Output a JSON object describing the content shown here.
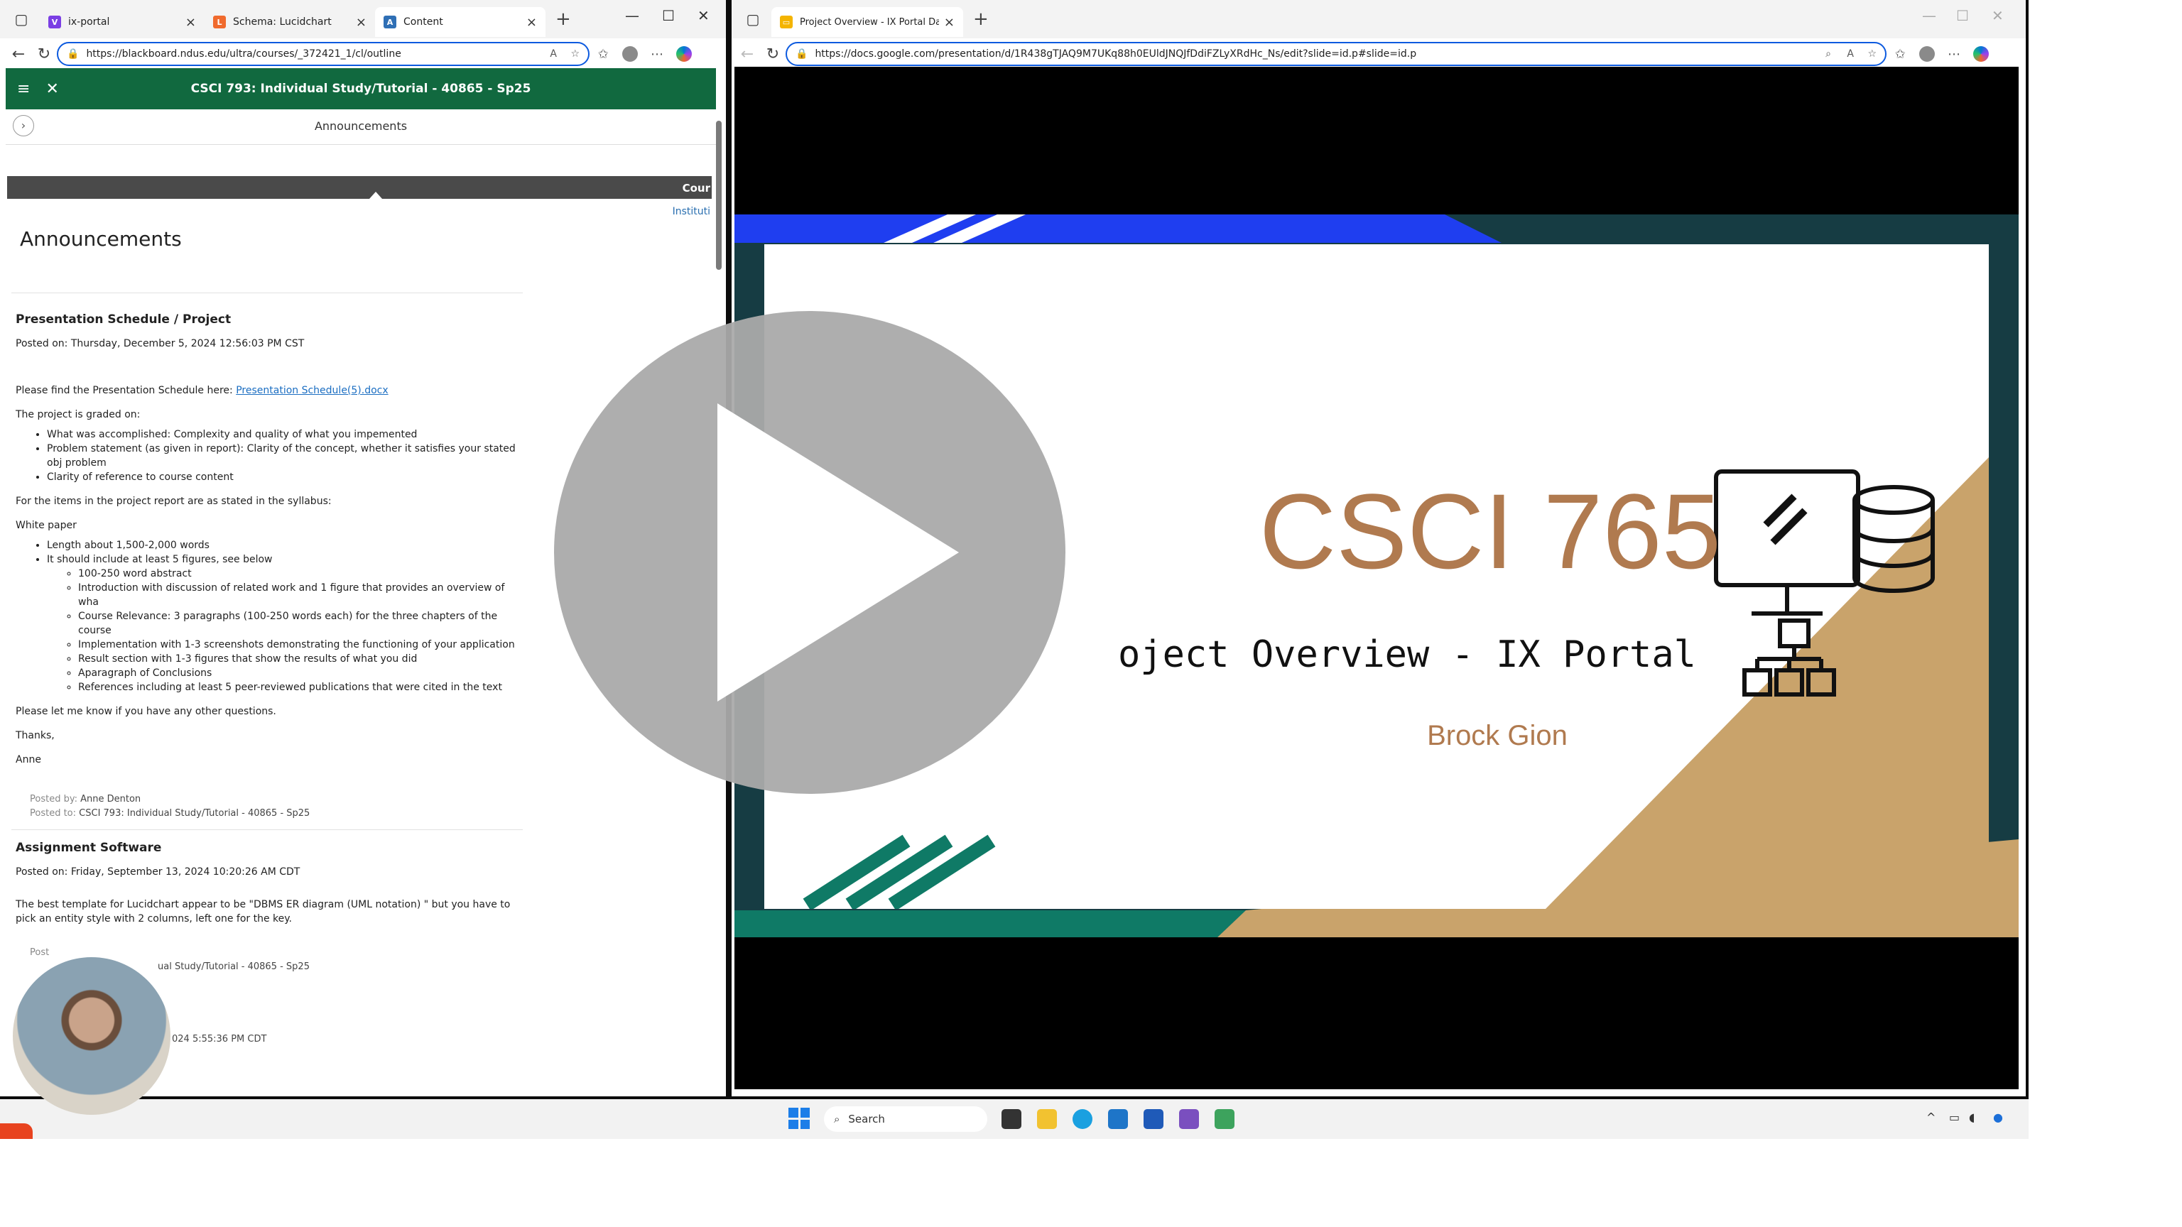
{
  "left_window": {
    "tabs": [
      {
        "label": "ix-portal",
        "color": "#7b3fe4"
      },
      {
        "label": "Schema: Lucidchart",
        "color": "#f06a2d"
      },
      {
        "label": "Content",
        "color": "#2f6fb5"
      }
    ],
    "url": "https://blackboard.ndus.edu/ultra/courses/_372421_1/cl/outline",
    "course_title": "CSCI 793: Individual Study/Tutorial - 40865 - Sp25",
    "panel_label": "Announcements",
    "grey_bar_text": "Cour",
    "inst_link": "Instituti",
    "page_heading": "Announcements",
    "posts": [
      {
        "title": "Presentation Schedule / Project",
        "posted_on": "Posted on: Thursday, December 5, 2024 12:56:03 PM CST",
        "intro": "Please find the Presentation Schedule here: ",
        "link": "Presentation Schedule(5).docx",
        "graded": "The project is graded on:",
        "criteria": [
          "What was accomplished: Complexity and quality of what you impemented",
          "Problem statement (as given in report): Clarity of the concept, whether it satisfies your stated obj problem",
          "Clarity of reference to course content"
        ],
        "syllabus": "For the items in the project report are as stated in the syllabus:",
        "white_paper": "White paper",
        "wp_items": [
          "Length about 1,500-2,000 words",
          "It should include at least 5 figures, see below"
        ],
        "wp_sub": [
          "100-250 word abstract",
          "Introduction with discussion of related work and 1 figure that provides an overview of wha",
          "Course Relevance: 3 paragraphs (100-250 words each) for the three chapters of the course",
          "Implementation with 1-3 screenshots demonstrating the functioning of your application",
          "Result section with 1-3 figures that show the results of what you did",
          "Aparagraph of Conclusions",
          "References including at least 5 peer-reviewed publications that were cited in the text"
        ],
        "closing": "Please let me know if you have any other questions.",
        "thanks": "Thanks,",
        "sign": "Anne",
        "posted_by_label": "Posted by: ",
        "posted_by": "Anne Denton",
        "posted_to_label": "Posted to: ",
        "posted_to": "CSCI 793: Individual Study/Tutorial - 40865 - Sp25"
      },
      {
        "title": "Assignment Software",
        "posted_on": "Posted on: Friday, September 13, 2024 10:20:26 AM CDT",
        "body": "The best template for Lucidchart appear to be \"DBMS ER diagram (UML notation) \" but you have to pick an entity style with 2 columns, left one for the key.",
        "meta_partial_1": "Post",
        "meta_partial_2": "ual Study/Tutorial - 40865 - Sp25",
        "meta_partial_3": "024 5:55:36 PM CDT"
      }
    ]
  },
  "right_window": {
    "tab_label": "Project Overview - IX Portal Data",
    "url": "https://docs.google.com/presentation/d/1R438gTJAQ9M7UKq88h0EUldJNQJfDdiFZLyXRdHc_Ns/edit?slide=id.p#slide=id.p",
    "slide": {
      "title": "CSCI 765",
      "subtitle": "oject Overview - IX Portal",
      "author": "Brock Gion",
      "accent": "#b07a4f"
    }
  },
  "taskbar": {
    "search": "Search"
  }
}
